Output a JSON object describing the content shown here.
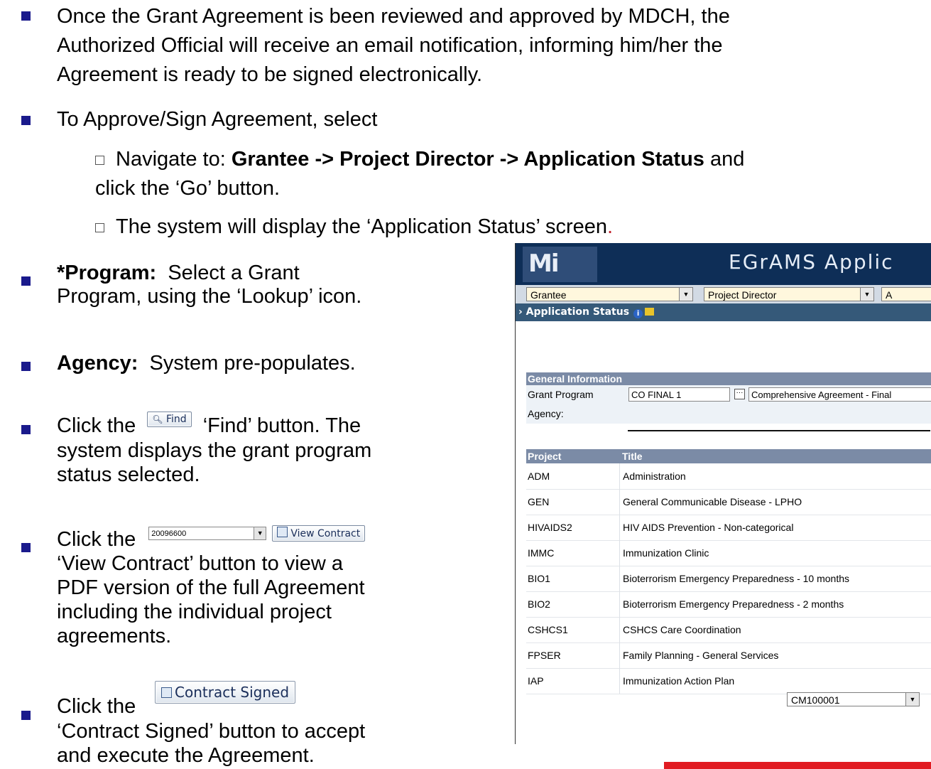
{
  "intro": {
    "line1": "Once the Grant Agreement is been reviewed and approved by MDCH, the",
    "line2": "Authorized Official will receive an email notification, informing him/her the",
    "line3": "Agreement is ready to be signed electronically."
  },
  "approve": {
    "lead": "To Approve/Sign Agreement, select",
    "nav_prefix": "Navigate to: ",
    "nav_path": "Grantee -> Project Director -> Application Status",
    "nav_suffix": " and",
    "nav_line2": "click the ‘Go’ button.",
    "display_text": "The system will display the ‘Application Status’ screen",
    "display_dot": "."
  },
  "steps": {
    "program_label": "*Program:",
    "program_text1": "Select a Grant",
    "program_text2": "Program, using the ‘Lookup’ icon.",
    "agency_label": "Agency:",
    "agency_text": "System pre-populates.",
    "find_prefix": "Click the",
    "find_button": "Find",
    "find_text1": "‘Find’ button.  The",
    "find_text2": "system displays the grant program",
    "find_text3": "status selected.",
    "view_prefix": "Click the",
    "view_select_value": "20096600",
    "view_button": "View Contract",
    "view_text1": "‘View Contract’ button to view a",
    "view_text2": "PDF version of the full Agreement",
    "view_text3": "including the individual project",
    "view_text4": "agreements.",
    "signed_button": "Contract Signed",
    "signed_prefix": "Click the",
    "signed_text1": "‘Contract Signed’ button to accept",
    "signed_text2": "and execute the Agreement."
  },
  "screenshot": {
    "logo_text": "Mi",
    "app_title": "EGrAMS Applic",
    "role_select": "Grantee",
    "position_select": "Project Director",
    "third_select": "A",
    "breadcrumb": "Application Status",
    "general_info_header": "General Information",
    "grant_program_label": "Grant Program",
    "grant_program_value": "CO FINAL 1",
    "grant_program_desc": "Comprehensive Agreement - Final",
    "agency_label": "Agency:",
    "columns": [
      "Project",
      "Title"
    ],
    "projects": [
      {
        "project": "ADM",
        "title": "Administration"
      },
      {
        "project": "GEN",
        "title": "General Communicable Disease - LPHO"
      },
      {
        "project": "HIVAIDS2",
        "title": "HIV AIDS Prevention - Non-categorical"
      },
      {
        "project": "IMMC",
        "title": "Immunization Clinic"
      },
      {
        "project": "BIO1",
        "title": "Bioterrorism Emergency Preparedness - 10 months"
      },
      {
        "project": "BIO2",
        "title": "Bioterrorism Emergency Preparedness - 2 months"
      },
      {
        "project": "CSHCS1",
        "title": "CSHCS Care Coordination"
      },
      {
        "project": "FPSER",
        "title": "Family Planning - General Services"
      },
      {
        "project": "IAP",
        "title": "Immunization Action Plan"
      }
    ],
    "bottom_select": "CM100001"
  },
  "colors": {
    "bullet": "#1a1a8c",
    "accent_red": "#e11b22",
    "header_navy": "#0e2e57"
  }
}
